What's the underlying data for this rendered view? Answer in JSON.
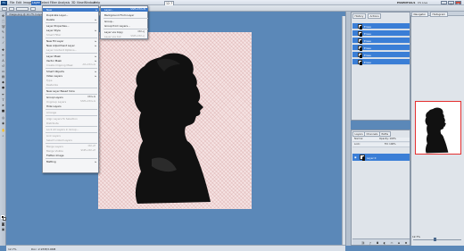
{
  "menubar": {
    "logo": "Ps",
    "items": [
      {
        "label": "File"
      },
      {
        "label": "Edit"
      },
      {
        "label": "Image"
      },
      {
        "label": "Layer"
      },
      {
        "label": "Select"
      },
      {
        "label": "Filter"
      },
      {
        "label": "Analysis"
      },
      {
        "label": "3D"
      },
      {
        "label": "View"
      },
      {
        "label": "Window"
      },
      {
        "label": "Help"
      }
    ],
    "zoom": "12.7",
    "workspace": "ESSENTIALS",
    "cs_live": "CS Live",
    "window_controls": [
      "–",
      "□",
      "×"
    ]
  },
  "document": {
    "tab": "image.png @ 12.7% (Layer 0, RGB/8) *"
  },
  "layer_menu": {
    "items": [
      {
        "label": "New",
        "shortcut": "",
        "submenu": true,
        "disabled": false,
        "highlight": true
      },
      {
        "label": "Duplicate Layer...",
        "shortcut": "",
        "submenu": false,
        "disabled": false
      },
      {
        "label": "Delete",
        "shortcut": "",
        "submenu": true,
        "disabled": false
      },
      {
        "label": "Layer Properties...",
        "shortcut": "",
        "submenu": false,
        "disabled": false
      },
      {
        "label": "Layer Style",
        "shortcut": "",
        "submenu": true,
        "disabled": false
      },
      {
        "label": "Smart Filter",
        "shortcut": "",
        "submenu": true,
        "disabled": true
      },
      {
        "label": "New Fill Layer",
        "shortcut": "",
        "submenu": true,
        "disabled": false
      },
      {
        "label": "New Adjustment Layer",
        "shortcut": "",
        "submenu": true,
        "disabled": false
      },
      {
        "label": "Layer Content Options...",
        "shortcut": "",
        "submenu": false,
        "disabled": true
      },
      {
        "label": "Layer Mask",
        "shortcut": "",
        "submenu": true,
        "disabled": false
      },
      {
        "label": "Vector Mask",
        "shortcut": "",
        "submenu": true,
        "disabled": false
      },
      {
        "label": "Create Clipping Mask",
        "shortcut": "Alt+Ctrl+G",
        "submenu": false,
        "disabled": true
      },
      {
        "label": "Smart Objects",
        "shortcut": "",
        "submenu": true,
        "disabled": false
      },
      {
        "label": "Video Layers",
        "shortcut": "",
        "submenu": true,
        "disabled": false
      },
      {
        "label": "Type",
        "shortcut": "",
        "submenu": true,
        "disabled": true
      },
      {
        "label": "Rasterize",
        "shortcut": "",
        "submenu": true,
        "disabled": true
      },
      {
        "label": "New Layer Based Slice",
        "shortcut": "",
        "submenu": false,
        "disabled": false
      },
      {
        "label": "Group Layers",
        "shortcut": "Ctrl+G",
        "submenu": false,
        "disabled": false
      },
      {
        "label": "Ungroup Layers",
        "shortcut": "Shift+Ctrl+G",
        "submenu": false,
        "disabled": true
      },
      {
        "label": "Hide Layers",
        "shortcut": "",
        "submenu": false,
        "disabled": false
      },
      {
        "label": "Arrange",
        "shortcut": "",
        "submenu": true,
        "disabled": true
      },
      {
        "label": "Align Layers To Selection",
        "shortcut": "",
        "submenu": true,
        "disabled": true
      },
      {
        "label": "Distribute",
        "shortcut": "",
        "submenu": true,
        "disabled": true
      },
      {
        "label": "Lock All Layers in Group...",
        "shortcut": "",
        "submenu": false,
        "disabled": true
      },
      {
        "label": "Link Layers",
        "shortcut": "",
        "submenu": false,
        "disabled": true
      },
      {
        "label": "Select Linked Layers",
        "shortcut": "",
        "submenu": false,
        "disabled": true
      },
      {
        "label": "Merge Layers",
        "shortcut": "Ctrl+E",
        "submenu": false,
        "disabled": true
      },
      {
        "label": "Merge Visible",
        "shortcut": "Shift+Ctrl+E",
        "submenu": false,
        "disabled": true
      },
      {
        "label": "Flatten Image",
        "shortcut": "",
        "submenu": false,
        "disabled": false
      },
      {
        "label": "Matting",
        "shortcut": "",
        "submenu": true,
        "disabled": false
      }
    ]
  },
  "submenu": {
    "items": [
      {
        "label": "Layer...",
        "shortcut": "Shift+Ctrl+N",
        "disabled": false,
        "highlight": true
      },
      {
        "label": "Background From Layer",
        "shortcut": "",
        "disabled": false
      },
      {
        "label": "Group...",
        "shortcut": "",
        "disabled": false
      },
      {
        "label": "Group from Layers...",
        "shortcut": "",
        "disabled": false
      },
      {
        "label": "Layer via Copy",
        "shortcut": "Ctrl+J",
        "disabled": false
      },
      {
        "label": "Layer via Cut",
        "shortcut": "Shift+Ctrl+J",
        "disabled": true
      }
    ]
  },
  "history_panel": {
    "tabs": [
      "History",
      "Actions"
    ],
    "rows": [
      {
        "label": "Erase"
      },
      {
        "label": "Erase"
      },
      {
        "label": "Erase"
      },
      {
        "label": "Erase"
      },
      {
        "label": "Erase"
      },
      {
        "label": "Erase"
      }
    ]
  },
  "layers_panel": {
    "tabs": [
      "Layers",
      "Channels",
      "Paths"
    ],
    "blend_mode": "Normal",
    "opacity": "Opacity: 100%",
    "lock": "Lock:",
    "fill": "Fill: 100%",
    "layer_name": "Layer 0"
  },
  "navigator_panel": {
    "tabs": [
      "Navigator",
      "Histogram"
    ],
    "zoom": "12.7%"
  },
  "status": {
    "zoom": "12.7%",
    "doc": "Doc: 2.97M/3.96M"
  },
  "colors": {
    "workspace_bg": "#5b88b8",
    "highlight": "#3c78c8",
    "silhouette": "#111111"
  }
}
